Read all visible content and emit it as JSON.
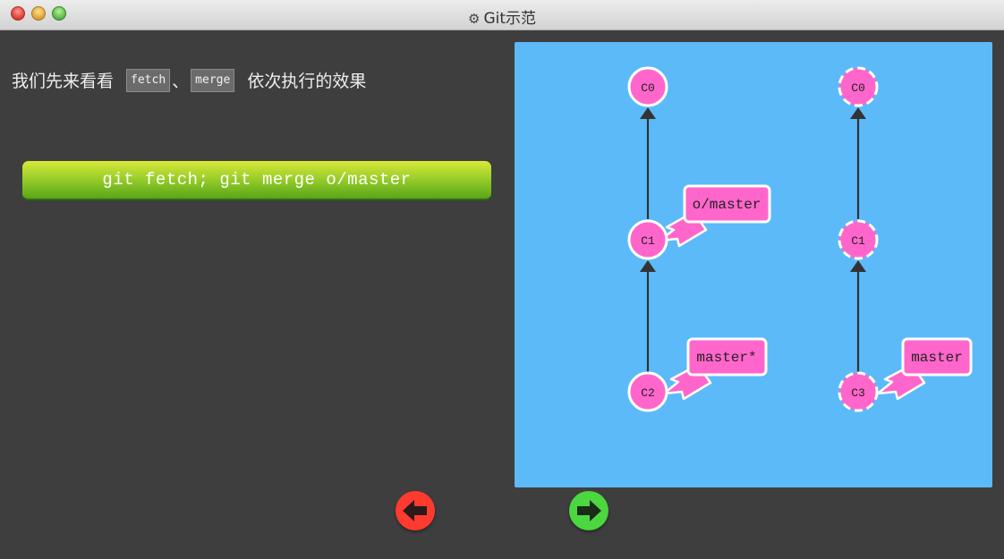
{
  "window": {
    "title": "Git示范",
    "title_icon": "gear-icon"
  },
  "instruction": {
    "prefix": "我们先来看看",
    "cmd1": "fetch",
    "separator": "、",
    "cmd2": "merge",
    "suffix": "依次执行的效果"
  },
  "command_button": {
    "label": "git fetch; git merge o/master"
  },
  "visualization": {
    "local_repo": {
      "commits": [
        "C0",
        "C1",
        "C2"
      ],
      "branches": [
        {
          "name": "o/master",
          "target": "C1"
        },
        {
          "name": "master*",
          "target": "C2"
        }
      ]
    },
    "remote_repo": {
      "commits": [
        "C0",
        "C1",
        "C3"
      ],
      "branches": [
        {
          "name": "master",
          "target": "C3"
        }
      ]
    },
    "colors": {
      "background": "#5cbaf9",
      "commit_fill": "#ff66cc",
      "branch_label_fill": "#ff66cc",
      "edge": "#333333"
    }
  },
  "navigation": {
    "back_icon": "arrow-left-icon",
    "forward_icon": "arrow-right-icon",
    "back_color": "#ff3b30",
    "forward_color": "#4cd63f"
  }
}
